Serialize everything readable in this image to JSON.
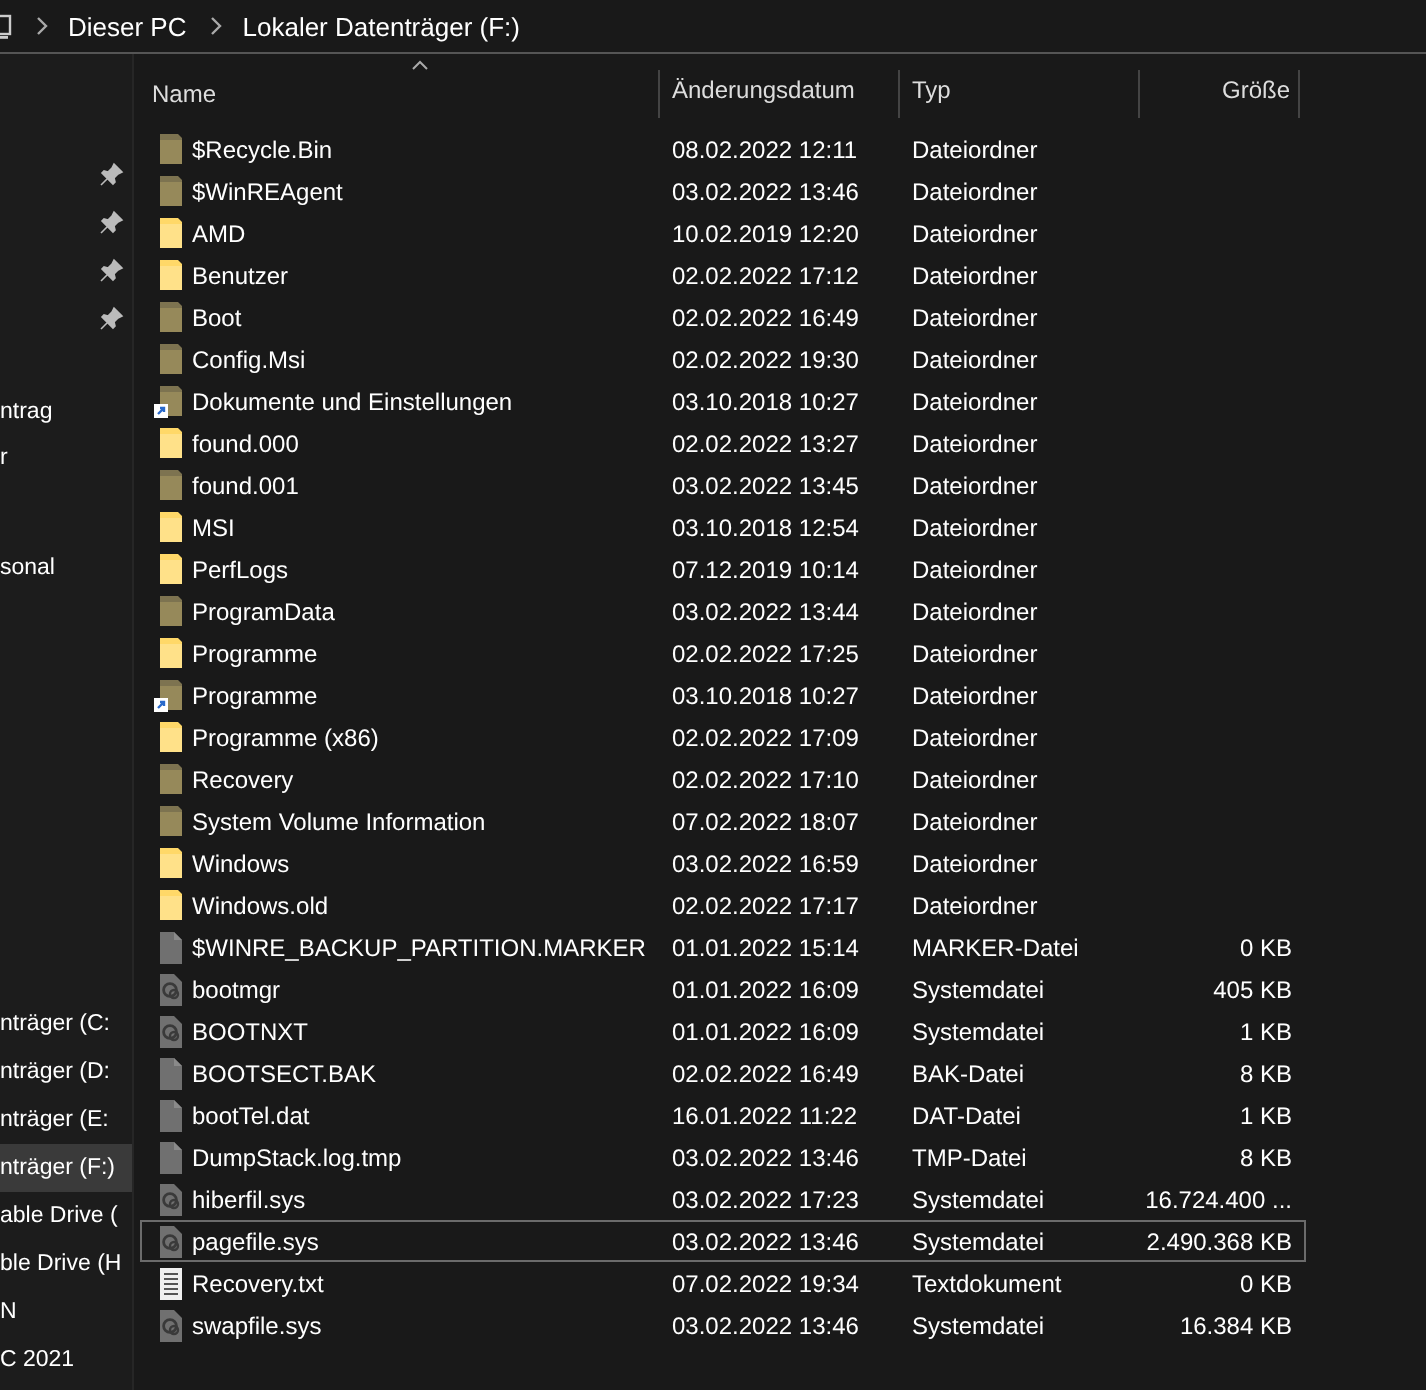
{
  "breadcrumb": [
    "Dieser PC",
    "Lokaler Datenträger (F:)"
  ],
  "sidebar": {
    "groups": [
      [
        {
          "pinned": true
        },
        {
          "pinned": true
        },
        {
          "pinned": true
        },
        {
          "pinned": true
        }
      ],
      [
        {
          "label": "ntrag",
          "pinned": false,
          "selected": false
        },
        {
          "label": "r",
          "pinned": false,
          "selected": false
        }
      ],
      [
        {
          "label": "sonal",
          "pinned": false,
          "selected": false
        }
      ],
      [
        {
          "label": "nträger (C:",
          "pinned": false,
          "selected": false
        },
        {
          "label": "nträger (D:",
          "pinned": false,
          "selected": false
        },
        {
          "label": "nträger (E:",
          "pinned": false,
          "selected": false
        },
        {
          "label": "nträger (F:)",
          "pinned": false,
          "selected": true
        },
        {
          "label": "able Drive (",
          "pinned": false,
          "selected": false
        },
        {
          "label": "ble Drive (H",
          "pinned": false,
          "selected": false
        },
        {
          "label": "N",
          "pinned": false,
          "selected": false
        },
        {
          "label": "C 2021",
          "pinned": false,
          "selected": false
        }
      ]
    ]
  },
  "table": {
    "columns": [
      "Name",
      "Änderungsdatum",
      "Typ",
      "Größe"
    ],
    "rows": [
      {
        "kind": "folder",
        "hidden": true,
        "shortcut": false,
        "selected": false,
        "name": "$Recycle.Bin",
        "date": "08.02.2022 12:11",
        "type": "Dateiordner"
      },
      {
        "kind": "folder",
        "hidden": true,
        "shortcut": false,
        "selected": false,
        "name": "$WinREAgent",
        "date": "03.02.2022 13:46",
        "type": "Dateiordner"
      },
      {
        "kind": "folder",
        "hidden": false,
        "shortcut": false,
        "selected": false,
        "name": "AMD",
        "date": "10.02.2019 12:20",
        "type": "Dateiordner"
      },
      {
        "kind": "folder",
        "hidden": false,
        "shortcut": false,
        "selected": false,
        "name": "Benutzer",
        "date": "02.02.2022 17:12",
        "type": "Dateiordner"
      },
      {
        "kind": "folder",
        "hidden": true,
        "shortcut": false,
        "selected": false,
        "name": "Boot",
        "date": "02.02.2022 16:49",
        "type": "Dateiordner"
      },
      {
        "kind": "folder",
        "hidden": true,
        "shortcut": false,
        "selected": false,
        "name": "Config.Msi",
        "date": "02.02.2022 19:30",
        "type": "Dateiordner"
      },
      {
        "kind": "folder",
        "hidden": true,
        "shortcut": true,
        "selected": false,
        "name": "Dokumente und Einstellungen",
        "date": "03.10.2018 10:27",
        "type": "Dateiordner"
      },
      {
        "kind": "folder",
        "hidden": false,
        "shortcut": false,
        "selected": false,
        "name": "found.000",
        "date": "02.02.2022 13:27",
        "type": "Dateiordner"
      },
      {
        "kind": "folder",
        "hidden": true,
        "shortcut": false,
        "selected": false,
        "name": "found.001",
        "date": "03.02.2022 13:45",
        "type": "Dateiordner"
      },
      {
        "kind": "folder",
        "hidden": false,
        "shortcut": false,
        "selected": false,
        "name": "MSI",
        "date": "03.10.2018 12:54",
        "type": "Dateiordner"
      },
      {
        "kind": "folder",
        "hidden": false,
        "shortcut": false,
        "selected": false,
        "name": "PerfLogs",
        "date": "07.12.2019 10:14",
        "type": "Dateiordner"
      },
      {
        "kind": "folder",
        "hidden": true,
        "shortcut": false,
        "selected": false,
        "name": "ProgramData",
        "date": "03.02.2022 13:44",
        "type": "Dateiordner"
      },
      {
        "kind": "folder",
        "hidden": false,
        "shortcut": false,
        "selected": false,
        "name": "Programme",
        "date": "02.02.2022 17:25",
        "type": "Dateiordner"
      },
      {
        "kind": "folder",
        "hidden": true,
        "shortcut": true,
        "selected": false,
        "name": "Programme",
        "date": "03.10.2018 10:27",
        "type": "Dateiordner"
      },
      {
        "kind": "folder",
        "hidden": false,
        "shortcut": false,
        "selected": false,
        "name": "Programme (x86)",
        "date": "02.02.2022 17:09",
        "type": "Dateiordner"
      },
      {
        "kind": "folder",
        "hidden": true,
        "shortcut": false,
        "selected": false,
        "name": "Recovery",
        "date": "02.02.2022 17:10",
        "type": "Dateiordner"
      },
      {
        "kind": "folder",
        "hidden": true,
        "shortcut": false,
        "selected": false,
        "name": "System Volume Information",
        "date": "07.02.2022 18:07",
        "type": "Dateiordner"
      },
      {
        "kind": "folder",
        "hidden": false,
        "shortcut": false,
        "selected": false,
        "name": "Windows",
        "date": "03.02.2022 16:59",
        "type": "Dateiordner"
      },
      {
        "kind": "folder",
        "hidden": false,
        "shortcut": false,
        "selected": false,
        "name": "Windows.old",
        "date": "02.02.2022 17:17",
        "type": "Dateiordner"
      },
      {
        "kind": "file",
        "hidden": true,
        "shortcut": false,
        "selected": false,
        "name": "$WINRE_BACKUP_PARTITION.MARKER",
        "date": "01.01.2022 15:14",
        "type": "MARKER-Datei",
        "size": "0 KB"
      },
      {
        "kind": "system",
        "hidden": true,
        "shortcut": false,
        "selected": false,
        "name": "bootmgr",
        "date": "01.01.2022 16:09",
        "type": "Systemdatei",
        "size": "405 KB"
      },
      {
        "kind": "system",
        "hidden": true,
        "shortcut": false,
        "selected": false,
        "name": "BOOTNXT",
        "date": "01.01.2022 16:09",
        "type": "Systemdatei",
        "size": "1 KB"
      },
      {
        "kind": "file",
        "hidden": true,
        "shortcut": false,
        "selected": false,
        "name": "BOOTSECT.BAK",
        "date": "02.02.2022 16:49",
        "type": "BAK-Datei",
        "size": "8 KB"
      },
      {
        "kind": "file",
        "hidden": true,
        "shortcut": false,
        "selected": false,
        "name": "bootTel.dat",
        "date": "16.01.2022 11:22",
        "type": "DAT-Datei",
        "size": "1 KB"
      },
      {
        "kind": "file",
        "hidden": true,
        "shortcut": false,
        "selected": false,
        "name": "DumpStack.log.tmp",
        "date": "03.02.2022 13:46",
        "type": "TMP-Datei",
        "size": "8 KB"
      },
      {
        "kind": "system",
        "hidden": true,
        "shortcut": false,
        "selected": false,
        "name": "hiberfil.sys",
        "date": "03.02.2022 17:23",
        "type": "Systemdatei",
        "size": "16.724.400 ..."
      },
      {
        "kind": "system",
        "hidden": true,
        "shortcut": false,
        "selected": true,
        "name": "pagefile.sys",
        "date": "03.02.2022 13:46",
        "type": "Systemdatei",
        "size": "2.490.368 KB"
      },
      {
        "kind": "text",
        "hidden": false,
        "shortcut": false,
        "selected": false,
        "name": "Recovery.txt",
        "date": "07.02.2022 19:34",
        "type": "Textdokument",
        "size": "0 KB"
      },
      {
        "kind": "system",
        "hidden": true,
        "shortcut": false,
        "selected": false,
        "name": "swapfile.sys",
        "date": "03.02.2022 13:46",
        "type": "Systemdatei",
        "size": "16.384 KB"
      }
    ]
  }
}
